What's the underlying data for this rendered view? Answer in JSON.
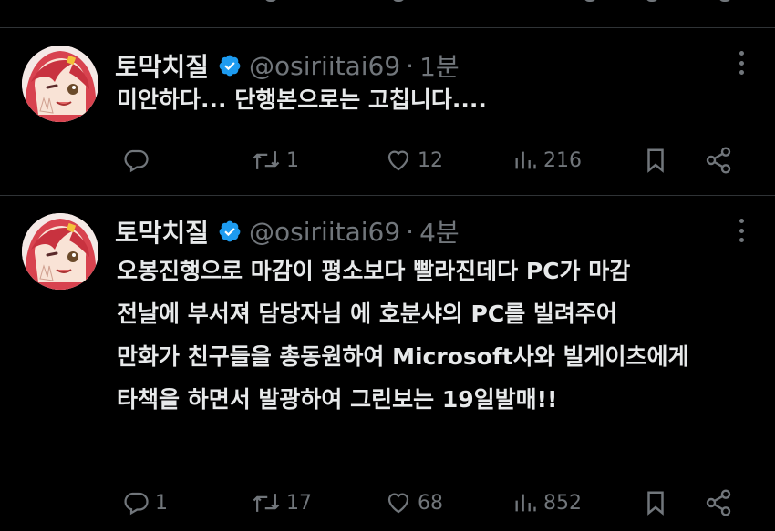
{
  "tweets": [
    {
      "display_name": "토막치질",
      "handle": "@osiriitai69",
      "separator": "·",
      "time": "1분",
      "text_lines": [
        "미안하다... 단행본으로는 고칩니다...."
      ],
      "counts": {
        "reply": "",
        "retweet": "1",
        "like": "12",
        "views": "216"
      }
    },
    {
      "display_name": "토막치질",
      "handle": "@osiriitai69",
      "separator": "·",
      "time": "4분",
      "text_lines": [
        "오봉진행으로 마감이 평소보다 빨라진데다 PC가 마감",
        "전날에 부서져 담당자님 에 호분샤의 PC를 빌려주어",
        "만화가 친구들을 총동원하여 Microsoft사와 빌게이츠에게",
        "타책을 하면서 발광하여 그린보는 19일발매!!"
      ],
      "counts": {
        "reply": "1",
        "retweet": "17",
        "like": "68",
        "views": "852"
      }
    }
  ],
  "icons": [
    "reply-icon",
    "retweet-icon",
    "like-icon",
    "views-icon",
    "bookmark-icon",
    "share-icon",
    "verified-badge-icon",
    "more-icon"
  ],
  "colors": {
    "background": "#000000",
    "text": "#e7e9ea",
    "muted": "#71767b",
    "verified": "#1d9bf0",
    "divider": "#2f3336"
  }
}
